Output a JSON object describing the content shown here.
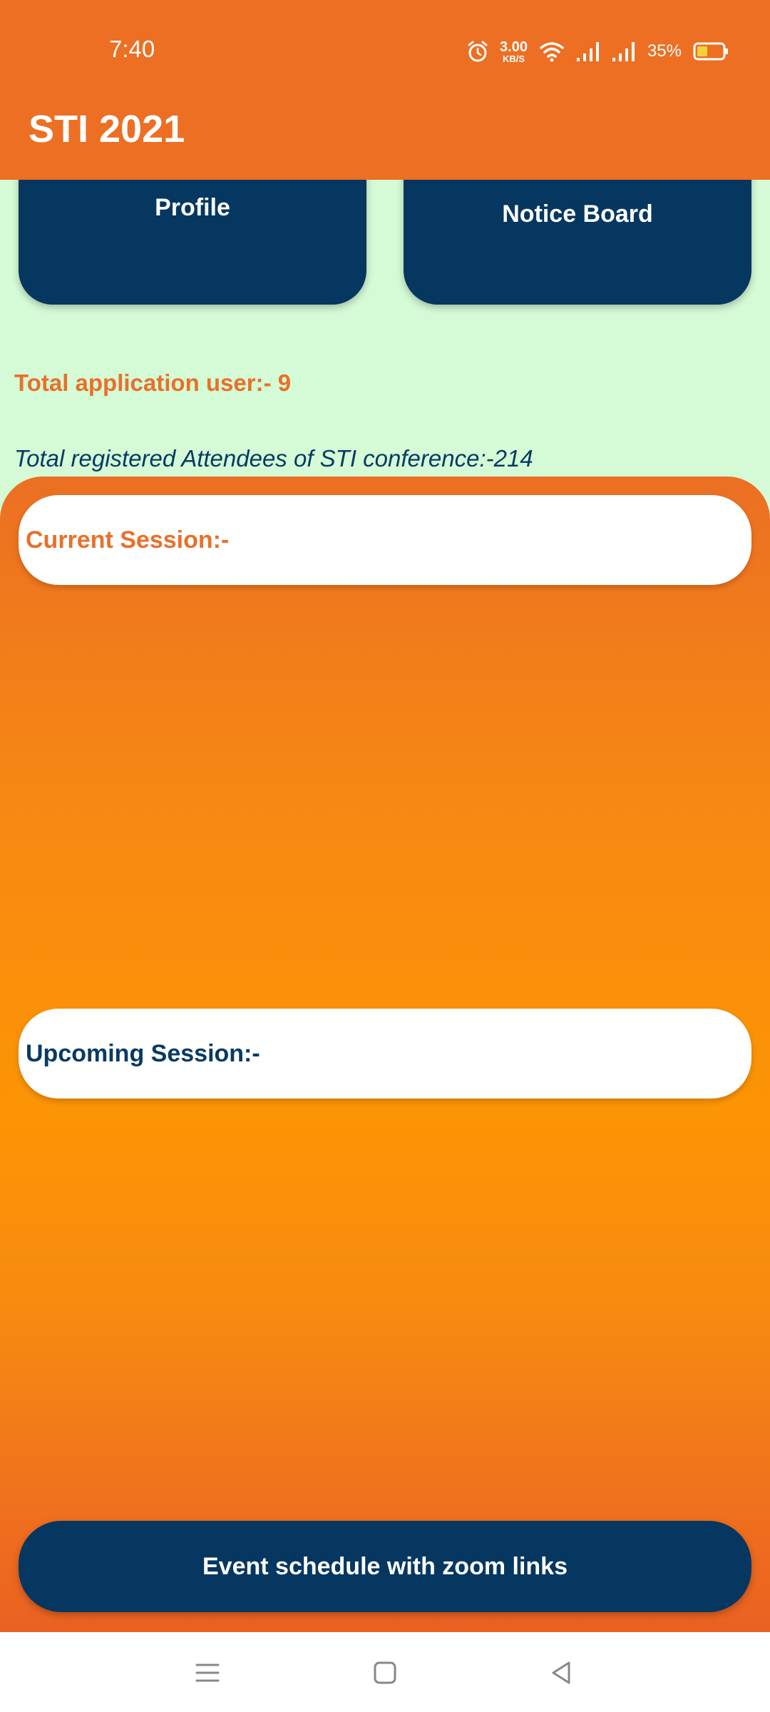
{
  "status_bar": {
    "time": "7:40",
    "net_speed_value": "3.00",
    "net_speed_unit": "KB/S",
    "battery_percent": "35%",
    "icons": [
      "alarm-icon",
      "wifi-icon",
      "signal-icon",
      "signal-icon",
      "battery-icon"
    ]
  },
  "app_bar": {
    "title": "STI 2021"
  },
  "cards": {
    "profile_label": "Profile",
    "notice_board_label": "Notice Board"
  },
  "stats": {
    "total_users_text": "Total application user:- 9",
    "total_attendees_text": "Total registered Attendees of STI conference:-214"
  },
  "sessions": {
    "current_label": "Current Session:-",
    "upcoming_label": "Upcoming Session:-"
  },
  "schedule_button_label": "Event schedule with zoom links",
  "nav_bar": {
    "icons": [
      "menu-icon",
      "home-icon",
      "back-icon"
    ]
  },
  "colors": {
    "accent_orange": "#ec6f23",
    "navy": "#063760",
    "mint_background": "#d4fad6"
  }
}
